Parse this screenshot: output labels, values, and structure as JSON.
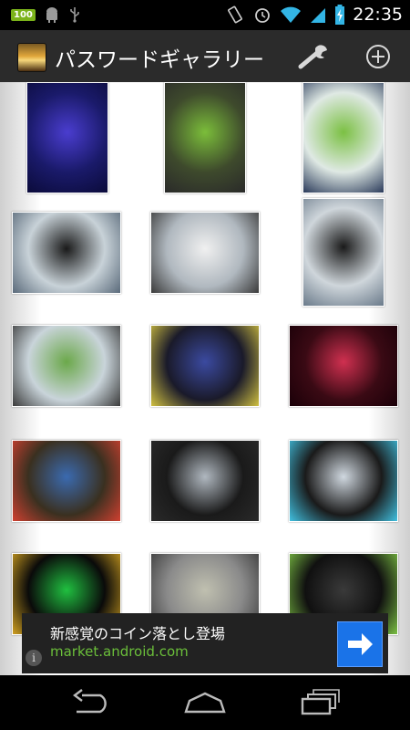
{
  "statusbar": {
    "battery_badge": "100",
    "time": "22:35"
  },
  "actionbar": {
    "title": "パスワードギャラリー",
    "settings_icon": "wrench-icon",
    "add_icon": "add-circle-icon"
  },
  "gallery": {
    "thumbnails": [
      {
        "name": "blue-stage-sculpture",
        "colors": [
          "#1a1a6a",
          "#4a3dcf",
          "#0b0b3a"
        ]
      },
      {
        "name": "android-figure-booth",
        "colors": [
          "#3e4a2c",
          "#7bbd3a",
          "#2a2a2a"
        ]
      },
      {
        "name": "android-robot-statue",
        "colors": [
          "#dfe9e4",
          "#7bc043",
          "#2a3a5a"
        ]
      },
      {
        "name": "nexus-q-sphere-hall",
        "colors": [
          "#c8d2d8",
          "#1a1a1a",
          "#5a6a7a"
        ]
      },
      {
        "name": "nexus-booth",
        "colors": [
          "#b0b8bf",
          "#f0f0f0",
          "#3a3a3a"
        ]
      },
      {
        "name": "nexus-q-sphere-closeup",
        "colors": [
          "#cfd6db",
          "#1a1a1a",
          "#6a7a8a"
        ]
      },
      {
        "name": "android-banner-hall",
        "colors": [
          "#c9d4da",
          "#6ba84a",
          "#3a3a3a"
        ]
      },
      {
        "name": "dark-stage-vehicle",
        "colors": [
          "#1a1a2a",
          "#3b4aa0",
          "#d0c040"
        ]
      },
      {
        "name": "red-lit-cake",
        "colors": [
          "#3a0a14",
          "#d03050",
          "#1a0008"
        ]
      },
      {
        "name": "dessert-table",
        "colors": [
          "#3a3020",
          "#3a6ab0",
          "#d04030"
        ]
      },
      {
        "name": "keynote-stage-phones",
        "colors": [
          "#1a1a1a",
          "#b0b8c0",
          "#2a2a2a"
        ]
      },
      {
        "name": "keynote-stage-glass",
        "colors": [
          "#1a1a1a",
          "#d0d8e0",
          "#40c0e0"
        ]
      },
      {
        "name": "green-screen-display",
        "colors": [
          "#0a0a0a",
          "#20c040",
          "#d0a020"
        ]
      },
      {
        "name": "aerial-city-presenters",
        "colors": [
          "#8a8a8a",
          "#c0c0b0",
          "#3a3a3a"
        ]
      },
      {
        "name": "jelly-bean-slide",
        "colors": [
          "#101010",
          "#3a3a3a",
          "#7bc043"
        ]
      }
    ]
  },
  "ad": {
    "headline": "新感覚のコイン落とし登場",
    "url": "market.android.com",
    "info_icon": "info-icon",
    "arrow_icon": "arrow-right-icon",
    "accent_color": "#1a73e8"
  },
  "navbar": {
    "back_icon": "back-icon",
    "home_icon": "home-icon",
    "recent_icon": "recent-apps-icon"
  }
}
